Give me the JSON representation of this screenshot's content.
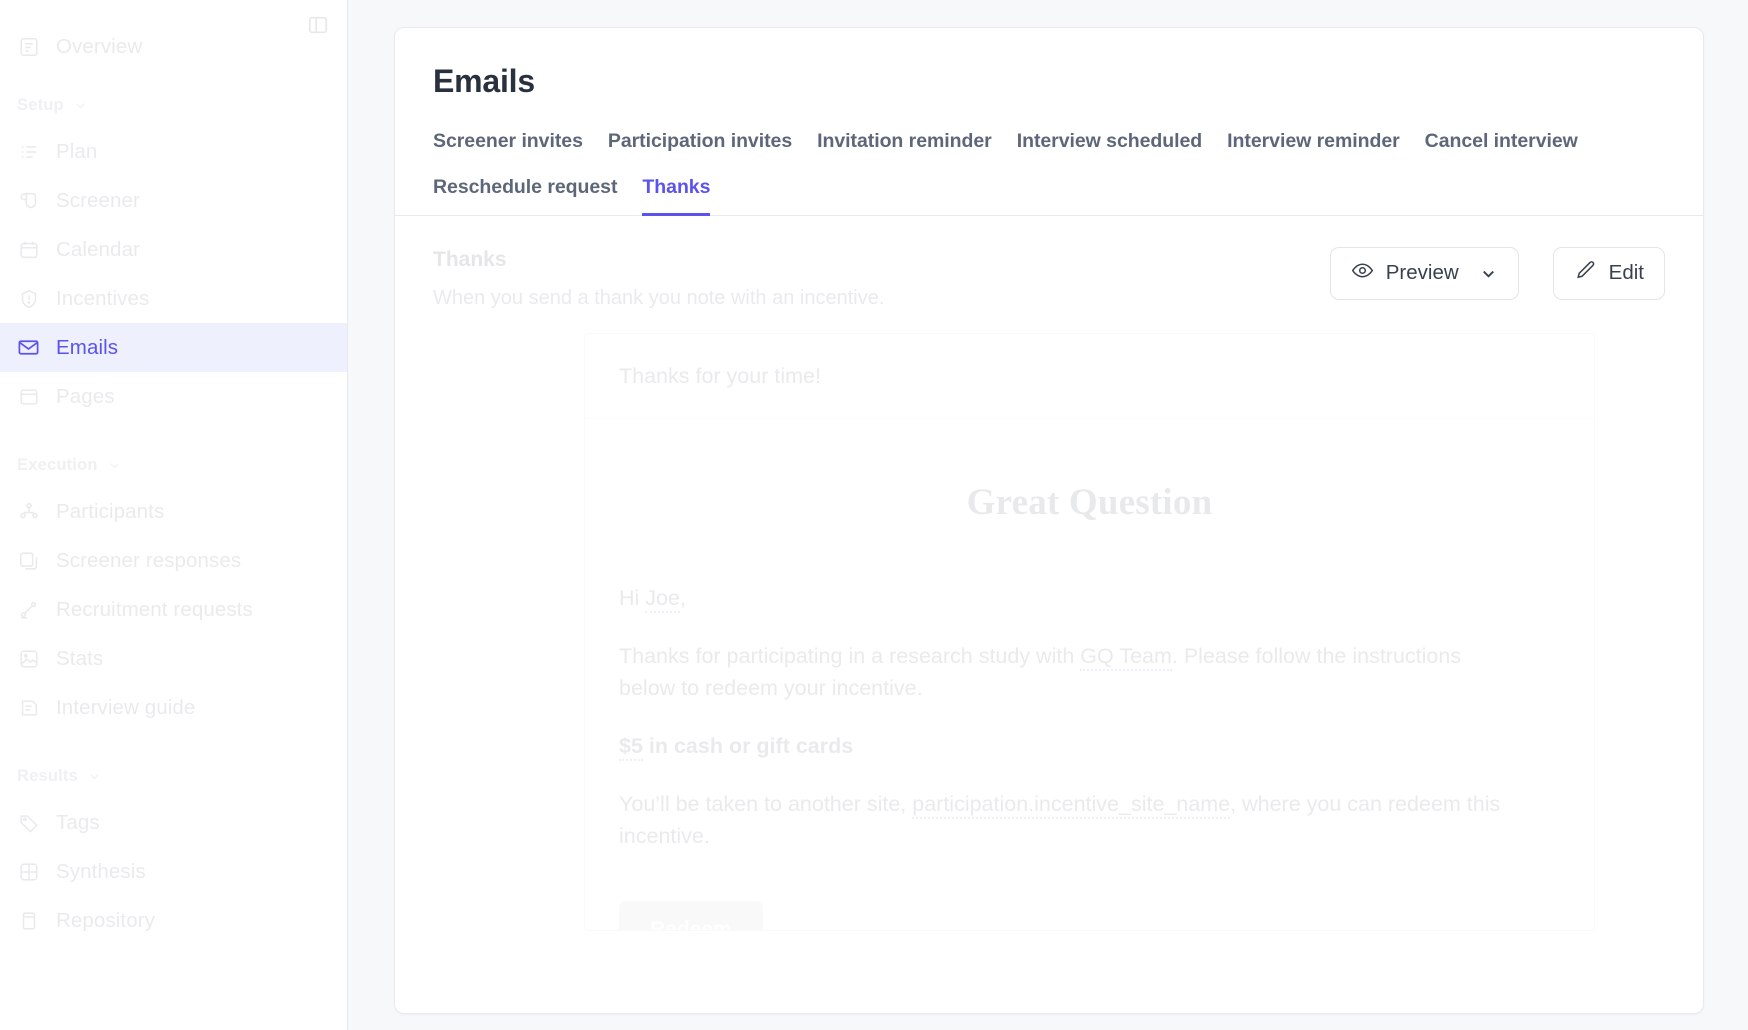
{
  "sidebar": {
    "panel_toggle_icon": "panel-toggle-icon",
    "overview": {
      "label": "Overview",
      "icon": "overview-icon"
    },
    "groups": [
      {
        "label": "Setup",
        "items": [
          {
            "label": "Plan",
            "icon": "list-icon",
            "active": false
          },
          {
            "label": "Screener",
            "icon": "screener-icon",
            "active": false
          },
          {
            "label": "Calendar",
            "icon": "calendar-icon",
            "active": false
          },
          {
            "label": "Incentives",
            "icon": "shield-icon",
            "active": false
          },
          {
            "label": "Emails",
            "icon": "mail-icon",
            "active": true
          },
          {
            "label": "Pages",
            "icon": "pages-icon",
            "active": false
          }
        ]
      },
      {
        "label": "Execution",
        "items": [
          {
            "label": "Participants",
            "icon": "participants-icon",
            "active": false
          },
          {
            "label": "Screener responses",
            "icon": "responses-icon",
            "active": false
          },
          {
            "label": "Recruitment requests",
            "icon": "recruitment-icon",
            "active": false
          },
          {
            "label": "Stats",
            "icon": "stats-icon",
            "active": false
          },
          {
            "label": "Interview guide",
            "icon": "guide-icon",
            "active": false
          }
        ]
      },
      {
        "label": "Results",
        "items": [
          {
            "label": "Tags",
            "icon": "tag-icon",
            "active": false
          },
          {
            "label": "Synthesis",
            "icon": "synthesis-icon",
            "active": false
          },
          {
            "label": "Repository",
            "icon": "repository-icon",
            "active": false
          }
        ]
      }
    ]
  },
  "header": {
    "title": "Emails"
  },
  "tabs": [
    {
      "label": "Screener invites",
      "active": false
    },
    {
      "label": "Participation invites",
      "active": false
    },
    {
      "label": "Invitation reminder",
      "active": false
    },
    {
      "label": "Interview scheduled",
      "active": false
    },
    {
      "label": "Interview reminder",
      "active": false
    },
    {
      "label": "Cancel interview",
      "active": false
    },
    {
      "label": "Reschedule request",
      "active": false
    },
    {
      "label": "Thanks",
      "active": true
    }
  ],
  "section": {
    "title": "Thanks",
    "subtitle": "When you send a thank you note with an incentive.",
    "preview_label": "Preview",
    "edit_label": "Edit",
    "eye_icon": "eye-icon",
    "chevron_icon": "chevron-down-icon",
    "pencil_icon": "pencil-icon"
  },
  "email_preview": {
    "subject": "Thanks for your time!",
    "brand": "Great Question",
    "greeting_prefix": "Hi ",
    "greeting_var": "Joe",
    "greeting_suffix": ",",
    "body_1_a": "Thanks for participating in a research study with ",
    "body_1_var": "GQ Team",
    "body_1_b": ". Please follow the instructions below to redeem your incentive.",
    "amount_var": "$5",
    "amount_rest": " in cash or gift cards",
    "body_2_a": "You’ll be taken to another site, ",
    "body_2_var": "participation.incentive_site_name",
    "body_2_b": ", where you can redeem this incentive.",
    "cta_label": "Redeem"
  },
  "colors": {
    "accent": "#5b52ef",
    "accent_bg": "#eef0fe",
    "page_bg": "#f6f8fa",
    "card_border": "#e8eaee",
    "text": "#29313f",
    "muted": "#5e6779",
    "cta_bg": "#c9ccd3"
  }
}
